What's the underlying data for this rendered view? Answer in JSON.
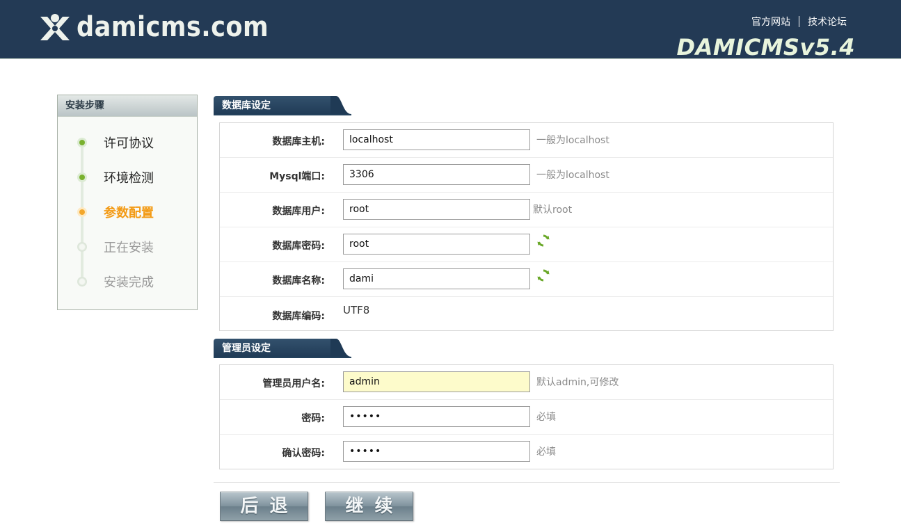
{
  "header": {
    "logo_text": "damicms.com",
    "links": [
      "官方网站",
      "技术论坛"
    ],
    "version": "DAMICMSv5.4"
  },
  "sidebar": {
    "title": "安装步骤",
    "steps": [
      {
        "label": "许可协议",
        "state": "done"
      },
      {
        "label": "环境检测",
        "state": "done"
      },
      {
        "label": "参数配置",
        "state": "active"
      },
      {
        "label": "正在安装",
        "state": "todo"
      },
      {
        "label": "安装完成",
        "state": "todo"
      }
    ]
  },
  "database": {
    "section_title": "数据库设定",
    "host_label": "数据库主机:",
    "host_value": "localhost",
    "host_hint": "一般为localhost",
    "port_label": "Mysql端口:",
    "port_value": "3306",
    "port_hint": "一般为localhost",
    "user_label": "数据库用户:",
    "user_value": "root",
    "user_hint": "默认root",
    "password_label": "数据库密码:",
    "password_value": "root",
    "name_label": "数据库名称:",
    "name_value": "dami",
    "charset_label": "数据库编码:",
    "charset_value": "UTF8"
  },
  "admin": {
    "section_title": "管理员设定",
    "username_label": "管理员用户名:",
    "username_value": "admin",
    "username_hint": "默认admin,可修改",
    "password_label": "密码:",
    "password_value": "•••••",
    "password_hint": "必填",
    "confirm_label": "确认密码:",
    "confirm_value": "•••••",
    "confirm_hint": "必填"
  },
  "buttons": {
    "back": "后退",
    "next": "继续"
  },
  "colors": {
    "header_bg": "#233a55",
    "active_step": "#f39a14",
    "done_step": "#79b12e",
    "refresh_icon": "#6aa829"
  }
}
